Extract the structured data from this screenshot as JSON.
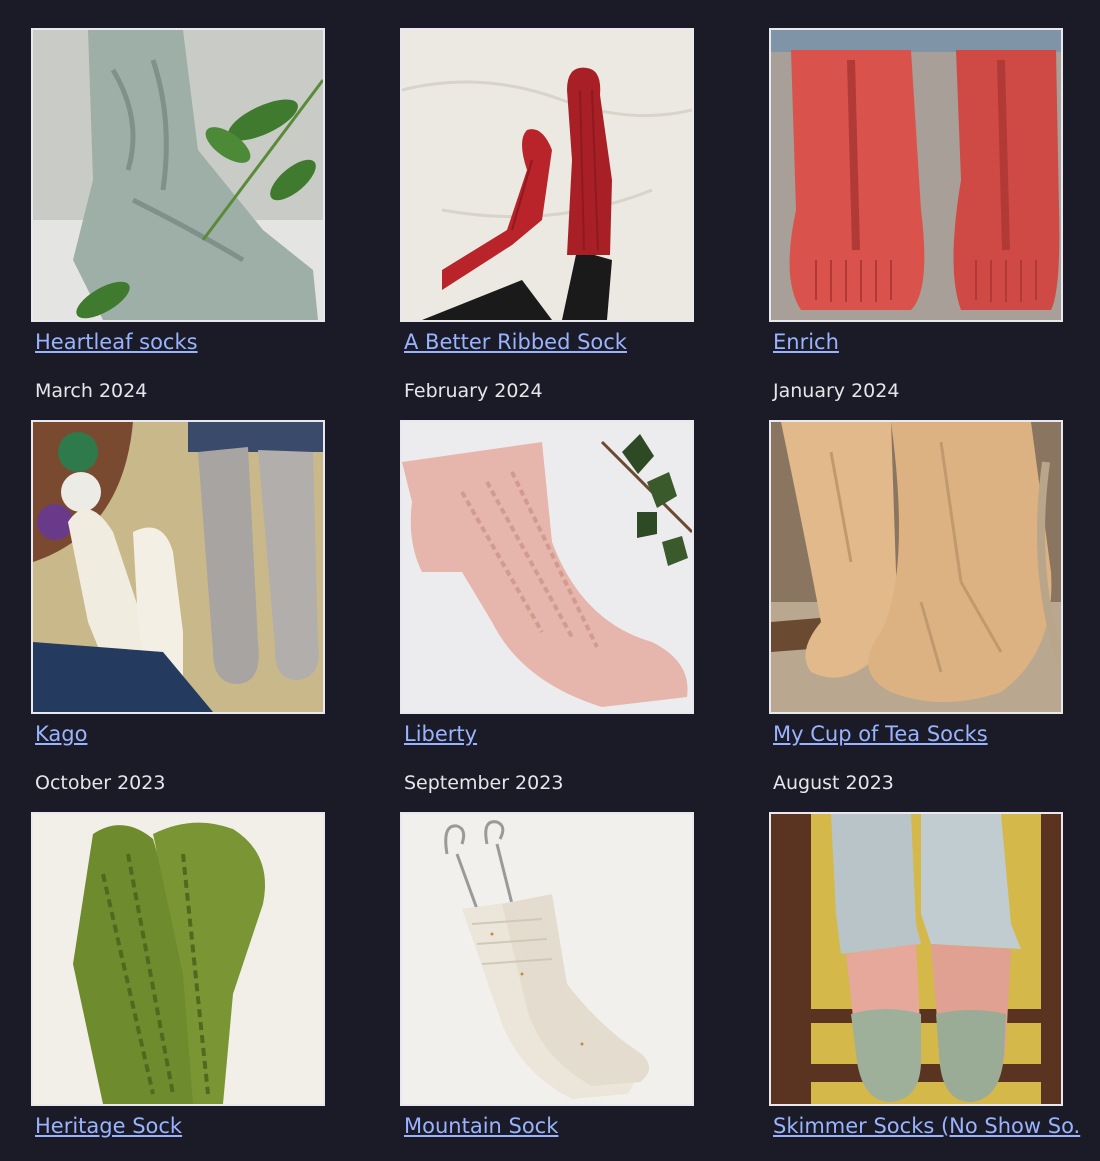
{
  "patterns": [
    {
      "title": "Heartleaf socks",
      "date": "March 2024",
      "photo": "grey-green lace socks with leaves",
      "colors": {
        "bg": "#c9ccc6",
        "sock": "#9eafa8",
        "accent": "#3f7a2e"
      }
    },
    {
      "title": "A Better Ribbed Sock",
      "date": "February 2024",
      "photo": "red ribbed socks on white sheet",
      "colors": {
        "bg": "#ece9e2",
        "sock": "#b8242a",
        "accent": "#1a1a1a"
      }
    },
    {
      "title": "Enrich",
      "date": "January 2024",
      "photo": "coral cabled socks from behind",
      "colors": {
        "bg": "#a89f98",
        "sock": "#d9524c",
        "accent": "#8094a8"
      }
    },
    {
      "title": "Kago",
      "date": "October 2023",
      "photo": "white and grey textured socks",
      "colors": {
        "bg": "#c9b98a",
        "sock": "#f1ece0",
        "accent": "#a8a4a2"
      }
    },
    {
      "title": "Liberty",
      "date": "September 2023",
      "photo": "pink lace socks with ivy",
      "colors": {
        "bg": "#ececef",
        "sock": "#e6b5ac",
        "accent": "#2e4a24"
      }
    },
    {
      "title": "My Cup of Tea Socks",
      "date": "August 2023",
      "photo": "tan lace socks on swing",
      "colors": {
        "bg": "#8a7560",
        "sock": "#e2b98a",
        "accent": "#6a4a30"
      }
    },
    {
      "title": "Heritage Sock",
      "date": "",
      "photo": "green lace socks flat",
      "colors": {
        "bg": "#f2eee8",
        "sock": "#6e8b2e",
        "accent": "#4f6a1e"
      }
    },
    {
      "title": "Mountain Sock",
      "date": "",
      "photo": "cream socks on blockers",
      "colors": {
        "bg": "#f2f0ec",
        "sock": "#ece6da",
        "accent": "#9a9a9a"
      }
    },
    {
      "title": "Skimmer Socks (No Show So.",
      "date": "",
      "photo": "sage no-show socks on ladder",
      "colors": {
        "bg": "#d4b84a",
        "sock": "#9fb09a",
        "accent": "#5a3420"
      }
    }
  ]
}
